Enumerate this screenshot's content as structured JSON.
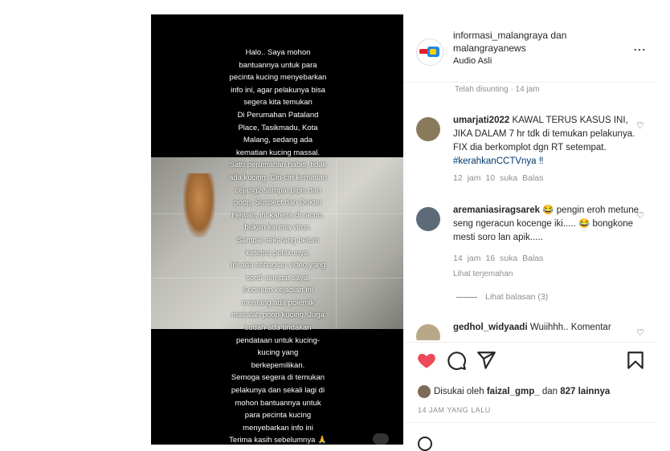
{
  "post": {
    "overlay_lines": [
      "Halo.. Saya mohon",
      "bantuannya untuk para",
      "pecinta kucing menyebarkan",
      "info ini, agar pelakunya bisa",
      "segera kita temukan",
      "Di Perumahan Pataland",
      "Place, Tasikmadu, Kota",
      "Malang, sedang ada",
      "kematian kucing massal.",
      "Satu perumahan habis, tidak",
      "ada kucing. Ciri-ciri kematian",
      "cejang2 sampai pipis dan",
      "poop. Suspect dari Dokter",
      "Hewan, ini karena di racun,",
      "bukan karena virus.",
      "Sampai sekarang belum",
      "ketemu pelakunya.",
      "Ini ada sebagian video yang",
      "sordi sempat saya.",
      "Sebelum kejadian ini",
      "memang ada polemik",
      "masalah poop kucing. Juga",
      "sudah ada tindakan",
      "pendataan untuk kucing-",
      "kucing yang",
      "berkepemilikan.",
      "Semoga segera di temukan",
      "pelakunya dan sekali lagi di",
      "mohon bantuannya untuk",
      "para pecinta kucing",
      "menyebarkan info ini",
      "Terima kasih sebelumnya 🙏"
    ]
  },
  "header": {
    "owner": "informasi_malangraya",
    "and_word": " dan",
    "coauthor": "malangrayanews",
    "audio": "Audio Asli",
    "more_icon": "more-icon"
  },
  "caption_meta": "Telah disunting · 14 jam",
  "comments": [
    {
      "user": "umarjati2022",
      "text": " KAWAL TERUS KASUS INI, JIKA DALAM 7 hr tdk di temukan pelakunya. FIX dia berkomplot dgn RT setempat. ",
      "tags": "#kerahkanCCTVnya ‼",
      "meta": "12 jam   10 suka   Balas",
      "avatar_color": "#8a7a5c"
    },
    {
      "user": "aremaniasiragsarek",
      "text": " 😂 pengin eroh metune seng ngeracun kocenge iki..... 😂 bongkone mesti soro lan apik.....",
      "tags": "",
      "meta": "14 jam   16 suka   Balas",
      "see_translation": "Lihat terjemahan",
      "avatar_color": "#5d6b78"
    },
    {
      "user": "gedhol_widyaadi",
      "text": " Wuiihhh.. Komentar",
      "tags": "",
      "avatar_color": "#b8a888"
    }
  ],
  "replies_label": "Lihat balasan (3)",
  "likes": {
    "prefix": "Disukai oleh ",
    "user": "faizal_gmp_",
    "suffix": " dan ",
    "count": "827 lainnya"
  },
  "date": "14 JAM YANG LALU",
  "colors": {
    "like_red": "#ed4956",
    "link_blue": "#00376b",
    "muted": "#8e8e8e"
  }
}
